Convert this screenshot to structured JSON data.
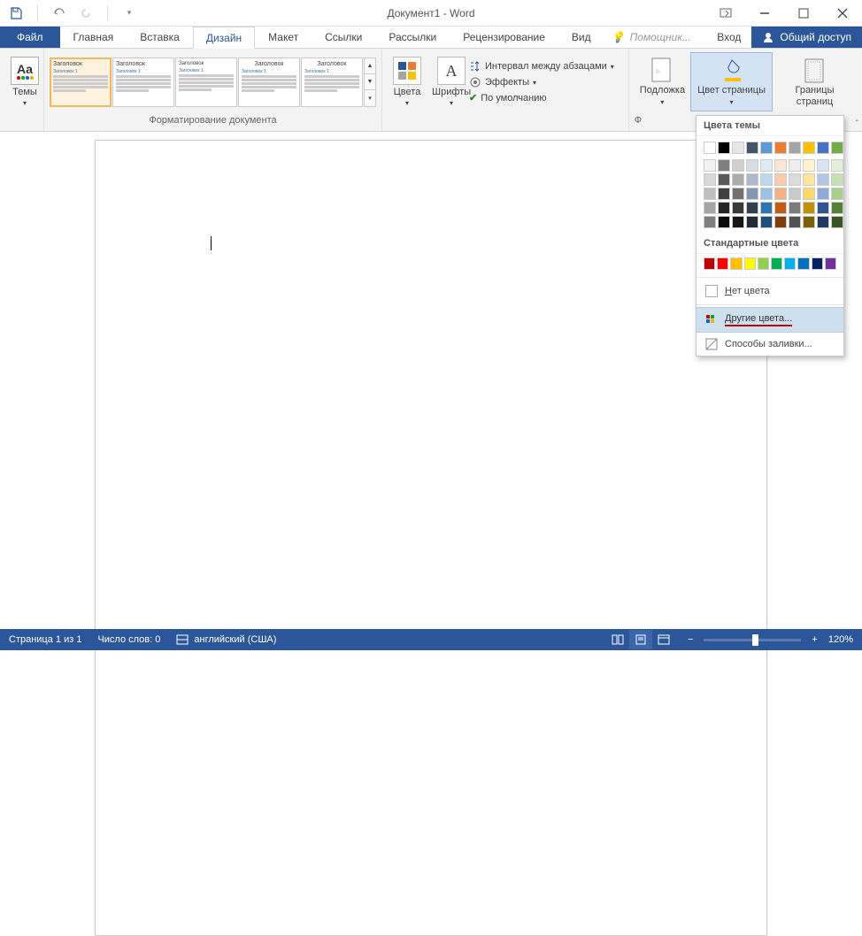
{
  "title": "Документ1 - Word",
  "tabs": {
    "file": "Файл",
    "home": "Главная",
    "insert": "Вставка",
    "design": "Дизайн",
    "layout": "Макет",
    "references": "Ссылки",
    "mailings": "Рассылки",
    "review": "Рецензирование",
    "view": "Вид",
    "tell_me": "Помощник...",
    "sign_in": "Вход",
    "share": "Общий доступ"
  },
  "ribbon": {
    "themes": "Темы",
    "doc_formatting": "Форматирование документа",
    "colors": "Цвета",
    "fonts": "Шрифты",
    "para_spacing": "Интервал между абзацами",
    "effects": "Эффекты",
    "set_default": "По умолчанию",
    "watermark": "Подложка",
    "page_color": "Цвет страницы",
    "page_borders": "Границы страниц",
    "style_heading": "Заголовок",
    "style_sub": "Заголовок 1",
    "page_bg_truncated": "Ф"
  },
  "popup": {
    "theme_colors": "Цвета темы",
    "standard_colors": "Стандартные цвета",
    "no_color": "Нет цвета",
    "more_colors": "Другие цвета...",
    "fill_effects": "Способы заливки...",
    "theme_rows": [
      [
        "#ffffff",
        "#000000",
        "#e7e6e6",
        "#44546a",
        "#5b9bd5",
        "#ed7d31",
        "#a5a5a5",
        "#ffc000",
        "#4472c4",
        "#70ad47"
      ],
      [
        "#f2f2f2",
        "#7f7f7f",
        "#d0cece",
        "#d6dce4",
        "#deebf6",
        "#fbe5d5",
        "#ededed",
        "#fff2cc",
        "#dae3f3",
        "#e2efd9"
      ],
      [
        "#d8d8d8",
        "#595959",
        "#aeabab",
        "#adb9ca",
        "#bdd7ee",
        "#f7cbac",
        "#dbdbdb",
        "#fee599",
        "#b4c6e7",
        "#c5e0b3"
      ],
      [
        "#bfbfbf",
        "#3f3f3f",
        "#757070",
        "#8496b0",
        "#9cc3e5",
        "#f4b183",
        "#c9c9c9",
        "#ffd965",
        "#8eaadb",
        "#a8d08d"
      ],
      [
        "#a5a5a5",
        "#262626",
        "#3a3838",
        "#323f4f",
        "#2e75b5",
        "#c55a11",
        "#7b7b7b",
        "#bf9000",
        "#2f5496",
        "#538135"
      ],
      [
        "#7f7f7f",
        "#0c0c0c",
        "#171616",
        "#222a35",
        "#1e4e79",
        "#833c0b",
        "#525252",
        "#7f6000",
        "#1f3864",
        "#375623"
      ]
    ],
    "standard_row": [
      "#c00000",
      "#ff0000",
      "#ffc000",
      "#ffff00",
      "#92d050",
      "#00b050",
      "#00b0f0",
      "#0070c0",
      "#002060",
      "#7030a0"
    ]
  },
  "status": {
    "page": "Страница 1 из 1",
    "words": "Число слов: 0",
    "lang": "английский (США)",
    "zoom": "120%"
  }
}
